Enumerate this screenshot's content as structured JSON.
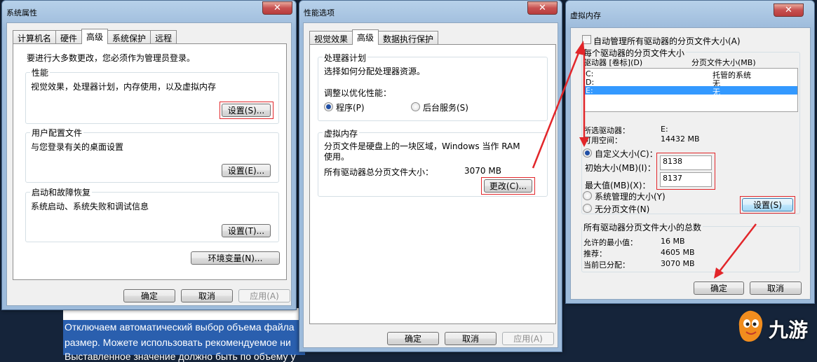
{
  "background": {
    "line1": "Отключаем автоматический выбор объема файла",
    "line2": "размер. Можете использовать рекомендуемое ни",
    "line3": "Выставленное значение должно быть по объему у"
  },
  "watermark": {
    "text": "九游"
  },
  "system_props": {
    "title": "系统属性",
    "tabs": [
      "计算机名",
      "硬件",
      "高级",
      "系统保护",
      "远程"
    ],
    "admin_note": "要进行大多数更改，您必须作为管理员登录。",
    "performance": {
      "label": "性能",
      "desc": "视觉效果，处理器计划，内存使用，以及虚拟内存",
      "button": "设置(S)..."
    },
    "user_profiles": {
      "label": "用户配置文件",
      "desc": "与您登录有关的桌面设置",
      "button": "设置(E)..."
    },
    "startup": {
      "label": "启动和故障恢复",
      "desc": "系统启动、系统失败和调试信息",
      "button": "设置(T)..."
    },
    "env_button": "环境变量(N)...",
    "ok": "确定",
    "cancel": "取消",
    "apply": "应用(A)"
  },
  "perf_options": {
    "title": "性能选项",
    "tabs": [
      "视觉效果",
      "高级",
      "数据执行保护"
    ],
    "cpu": {
      "label": "处理器计划",
      "desc": "选择如何分配处理器资源。",
      "adjust": "调整以优化性能：",
      "programs": "程序(P)",
      "services": "后台服务(S)"
    },
    "vm": {
      "label": "虚拟内存",
      "desc": "分页文件是硬盘上的一块区域，Windows 当作 RAM 使用。",
      "total_label": "所有驱动器总分页文件大小：",
      "total_value": "3070 MB",
      "change_button": "更改(C)..."
    },
    "ok": "确定",
    "cancel": "取消",
    "apply": "应用(A)"
  },
  "virtual_memory": {
    "title": "虚拟内存",
    "auto_manage": "自动管理所有驱动器的分页文件大小(A)",
    "per_drive": "每个驱动器的分页文件大小",
    "col_drive": "驱动器 [卷标](D)",
    "col_size": "分页文件大小(MB)",
    "drives": [
      {
        "drive": "C:",
        "size": "托管的系统",
        "selected": false
      },
      {
        "drive": "D:",
        "size": "无",
        "selected": false
      },
      {
        "drive": "E:",
        "size": "无",
        "selected": true
      }
    ],
    "selected_drive_label": "所选驱动器：",
    "selected_drive_value": "E:",
    "space_label": "可用空间：",
    "space_value": "14432 MB",
    "custom_size": "自定义大小(C)：",
    "initial_label": "初始大小(MB)(I)：",
    "initial_value": "8138",
    "max_label": "最大值(MB)(X)：",
    "max_value": "8137",
    "system_managed": "系统管理的大小(Y)",
    "no_paging": "无分页文件(N)",
    "set_button": "设置(S)",
    "totals_label": "所有驱动器分页文件大小的总数",
    "min_label": "允许的最小值：",
    "min_value": "16 MB",
    "rec_label": "推荐：",
    "rec_value": "4605 MB",
    "cur_label": "当前已分配：",
    "cur_value": "3070 MB",
    "ok": "确定",
    "cancel": "取消"
  },
  "colors": {
    "annotation_red": "#e2262a",
    "selection_blue": "#3399ff",
    "title_glass": "#9dbbdb"
  }
}
